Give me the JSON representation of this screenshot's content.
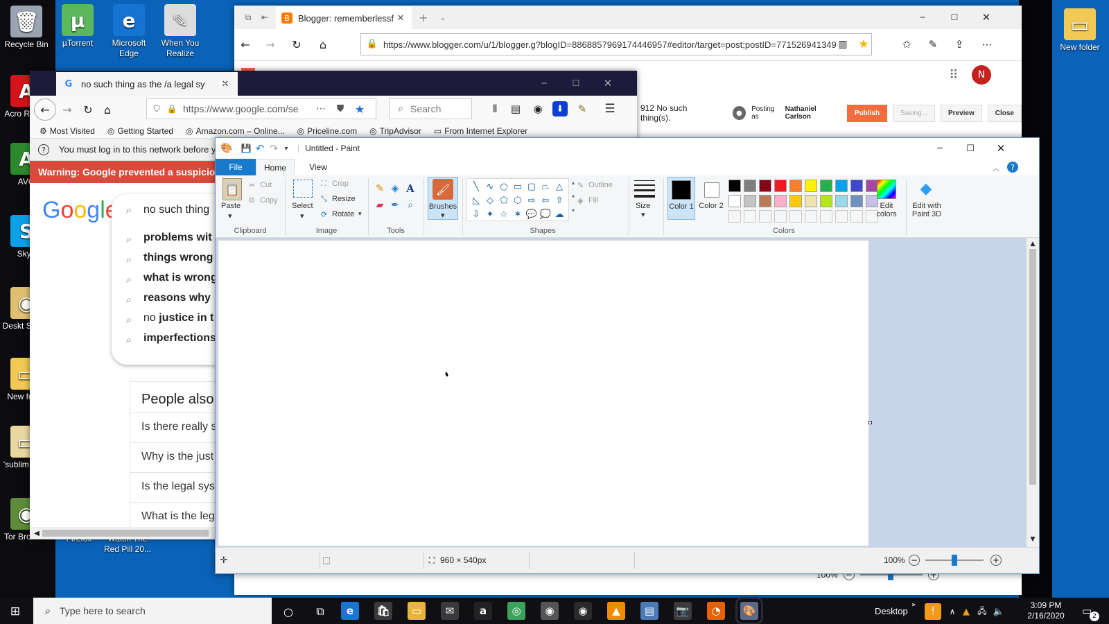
{
  "desktop": {
    "icons_left": [
      {
        "label": "Recycle Bin",
        "glyph": "🗑",
        "color": "#9aa4b0"
      },
      {
        "label": "Acro Reade",
        "glyph": "A",
        "color": "#d4141a"
      },
      {
        "label": "AVG",
        "glyph": "A",
        "color": "#2c8a2c"
      },
      {
        "label": "Skyp",
        "glyph": "S",
        "color": "#0aa1e8"
      },
      {
        "label": "Deskt Shortc",
        "glyph": "◉",
        "color": "#e0c070"
      },
      {
        "label": "New fo (3)",
        "glyph": "▭",
        "color": "#f2c955"
      },
      {
        "label": "'sublim folde",
        "glyph": "▭",
        "color": "#e8d8a0"
      },
      {
        "label": "Tor Browser",
        "glyph": "◉",
        "color": "#5e8c3a"
      }
    ],
    "icons_top": [
      {
        "label": "µTorrent",
        "glyph": "µ",
        "color": "#5cb85c"
      },
      {
        "label": "Microsoft Edge",
        "glyph": "e",
        "color": "#1673d1"
      },
      {
        "label": "When You Realize",
        "glyph": "✎",
        "color": "#dddddd"
      }
    ],
    "icons_bottom": [
      {
        "label": "Firefox"
      },
      {
        "label": "Watch The Red Pill 20..."
      }
    ],
    "icon_right": {
      "label": "New folder",
      "glyph": "▭",
      "color": "#f2c955"
    }
  },
  "edge": {
    "tab_title": "Blogger: rememberlessf",
    "url": "https://www.blogger.com/u/1/blogger.g?blogID=8868857969174446957#editor/target=post;postID=7715269413498",
    "avatar_letter": "N",
    "post_snippet": "912  No such thing(s).",
    "posting_as_prefix": "Posting as",
    "posting_as_name": "Nathaniel Carlson",
    "publish": "Publish",
    "saving": "Saving...",
    "preview": "Preview",
    "close": "Close",
    "zoom": "100%"
  },
  "firefox": {
    "tab_title": "no such thing as the /a legal sy",
    "url": "https://www.google.com/se",
    "search_placeholder": "Search",
    "bookmarks": [
      "Most Visited",
      "Getting Started",
      "Amazon.com – Online...",
      "Priceline.com",
      "TripAdvisor",
      "From Internet Explorer"
    ],
    "notice": "You must log in to this network before you",
    "warning": "Warning: Google prevented a suspicious",
    "logo": "Google",
    "query": "no such thing",
    "suggestions": [
      {
        "pre": "",
        "bold": "problems wit"
      },
      {
        "pre": "",
        "bold": "things wrong"
      },
      {
        "pre": "",
        "bold": "what is wrong"
      },
      {
        "pre": "",
        "bold": "reasons why"
      },
      {
        "pre": "no ",
        "bold": "justice in t"
      },
      {
        "pre": "",
        "bold": "imperfections"
      }
    ],
    "paa_title": "People also",
    "paa_items": [
      "Is there really s",
      "Why is the just",
      "Is the legal sys",
      "What is the leg"
    ]
  },
  "paint": {
    "title": "Untitled - Paint",
    "tabs": {
      "file": "File",
      "home": "Home",
      "view": "View"
    },
    "clipboard": {
      "paste": "Paste",
      "cut": "Cut",
      "copy": "Copy",
      "group": "Clipboard"
    },
    "image": {
      "select": "Select",
      "crop": "Crop",
      "resize": "Resize",
      "rotate": "Rotate",
      "group": "Image"
    },
    "tools": {
      "group": "Tools"
    },
    "brushes": "Brushes",
    "shapes": {
      "group": "Shapes",
      "outline": "Outline",
      "fill": "Fill"
    },
    "size": "Size",
    "color1": "Color 1",
    "color2": "Color 2",
    "colors_group": "Colors",
    "edit_colors": "Edit colors",
    "edit_3d": "Edit with Paint 3D",
    "palette_row1": [
      "#000000",
      "#7f7f7f",
      "#880015",
      "#ed1c24",
      "#ff7f27",
      "#fff200",
      "#22b14c",
      "#00a2e8",
      "#3f48cc",
      "#a349a4"
    ],
    "palette_row2": [
      "#ffffff",
      "#c3c3c3",
      "#b97a57",
      "#ffaec9",
      "#ffc90e",
      "#efe4b0",
      "#b5e61d",
      "#99d9ea",
      "#7092be",
      "#c8bfe7"
    ],
    "dimensions": "960 × 540px",
    "zoom": "100%"
  },
  "taskbar": {
    "search_placeholder": "Type here to search",
    "desktop_label": "Desktop",
    "time": "3:09 PM",
    "date": "2/16/2020",
    "notif_count": "2"
  }
}
